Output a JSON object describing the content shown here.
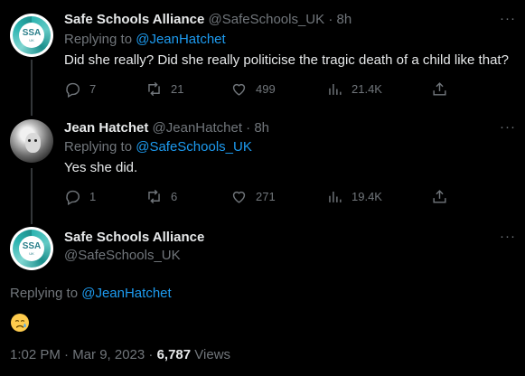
{
  "tweets": [
    {
      "name": "Safe Schools Alliance",
      "handle": "@SafeSchools_UK",
      "time": "8h",
      "replying_label": "Replying to",
      "replying_to": "@JeanHatchet",
      "text": "Did she really? Did she really politicise the tragic death of a child like that?",
      "stats": {
        "replies": "7",
        "retweets": "21",
        "likes": "499",
        "views": "21.4K"
      },
      "avatar_text": "SSA",
      "avatar_sub": "UK"
    },
    {
      "name": "Jean Hatchet",
      "handle": "@JeanHatchet",
      "time": "8h",
      "replying_label": "Replying to",
      "replying_to": "@SafeSchools_UK",
      "text": "Yes she did.",
      "stats": {
        "replies": "1",
        "retweets": "6",
        "likes": "271",
        "views": "19.4K"
      }
    }
  ],
  "main_tweet": {
    "name": "Safe Schools Alliance",
    "handle": "@SafeSchools_UK",
    "replying_label": "Replying to",
    "replying_to": "@JeanHatchet",
    "emoji": "sad-but-relieved-face",
    "timestamp": "1:02 PM · Mar 9, 2023 ·",
    "views_count": "6,787",
    "views_label": "Views",
    "avatar_text": "SSA",
    "avatar_sub": "UK"
  },
  "separator": "·",
  "more_glyph": "···",
  "colors": {
    "background": "#000000",
    "text": "#e7e9ea",
    "muted": "#71767b",
    "link": "#1d9bf0",
    "ssa_teal": "#2bb3b0"
  }
}
